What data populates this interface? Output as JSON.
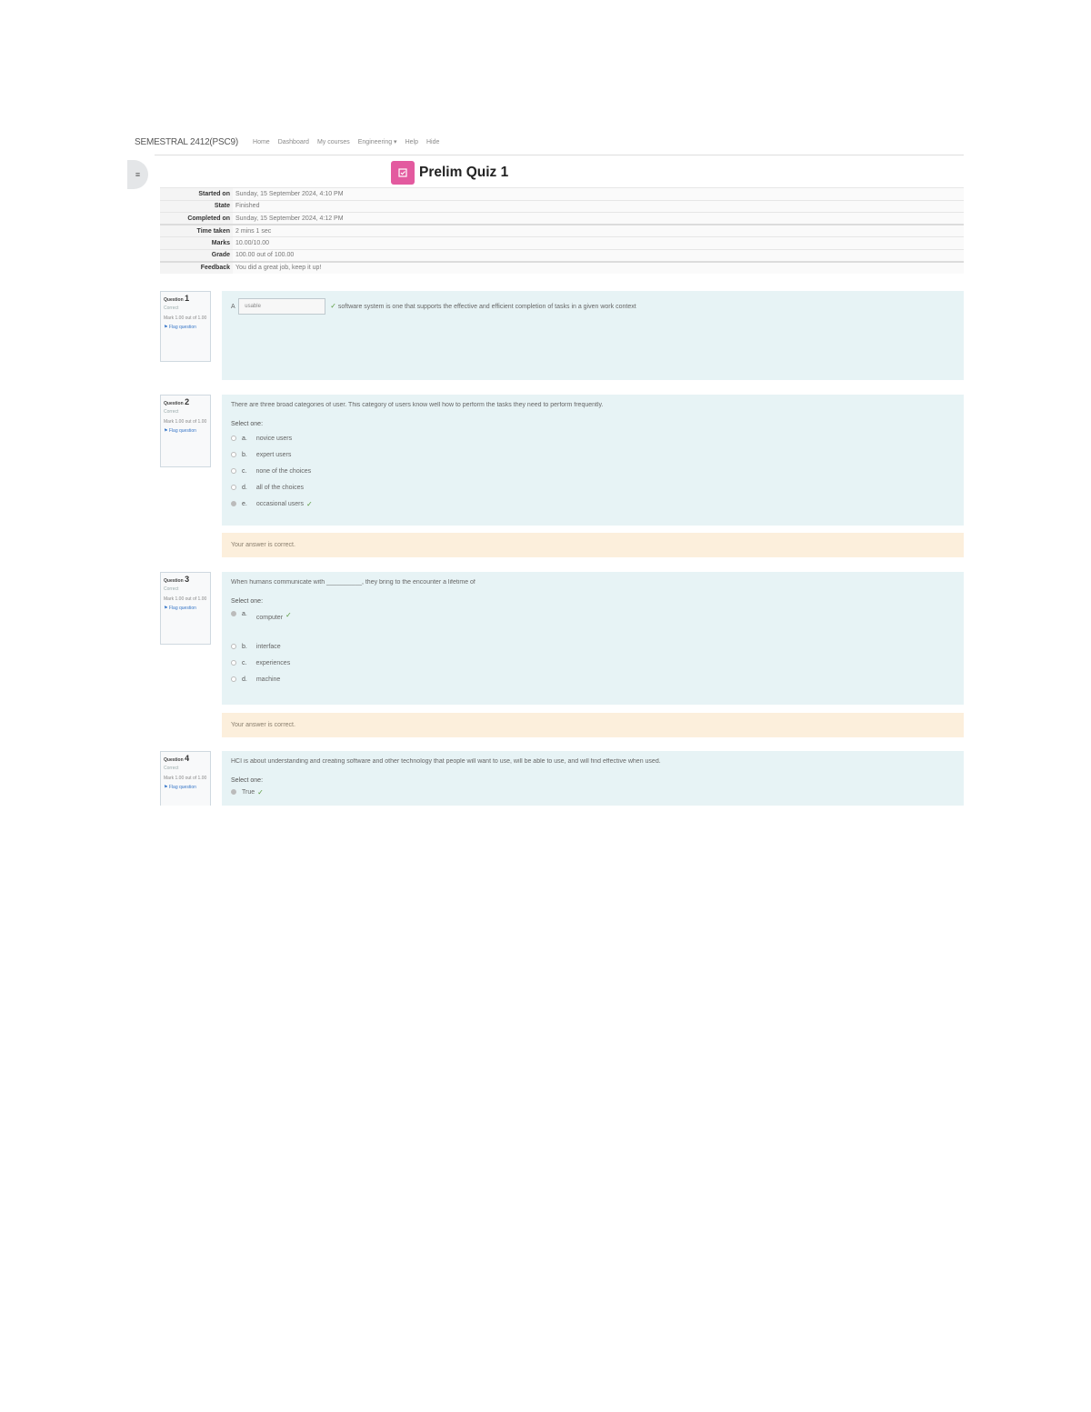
{
  "header": {
    "site_name": "SEMESTRAL 2412(PSC9)",
    "nav": [
      "Home",
      "Dashboard",
      "My courses",
      "Engineering ▾",
      "Help",
      "Hide"
    ]
  },
  "drawer_icon": "≡",
  "quiz": {
    "icon": "quiz-icon",
    "title": "Prelim Quiz 1"
  },
  "summary": [
    {
      "label": "Started on",
      "value": "Sunday, 15 September 2024, 4:10 PM"
    },
    {
      "label": "State",
      "value": "Finished"
    },
    {
      "label": "Completed on",
      "value": "Sunday, 15 September 2024, 4:12 PM"
    },
    {
      "label": "Time taken",
      "value": "2 mins 1 sec"
    },
    {
      "label": "Marks",
      "value": "10.00/10.00"
    },
    {
      "label": "Grade",
      "value": "100.00 out of 100.00"
    },
    {
      "label": "Feedback",
      "value": "You did a great job, keep it up!"
    }
  ],
  "questions": [
    {
      "number_label": "Question",
      "number": "1",
      "state": "Correct",
      "mark": "Mark 1.00 out of 1.00",
      "flag": "Flag question",
      "text_before": "A",
      "answer": "usable",
      "text_after": "software system is one that supports the effective and efficient completion of tasks in a given work context"
    },
    {
      "number_label": "Question",
      "number": "2",
      "state": "Correct",
      "mark": "Mark 1.00 out of 1.00",
      "flag": "Flag question",
      "text": "There are three broad categories of user. This category of users know well how to perform the tasks they need to perform frequently.",
      "select_one": "Select one:",
      "options": [
        {
          "letter": "a.",
          "text": "novice users"
        },
        {
          "letter": "b.",
          "text": "expert users"
        },
        {
          "letter": "c.",
          "text": "none of the choices"
        },
        {
          "letter": "d.",
          "text": "all of the choices"
        },
        {
          "letter": "e.",
          "text": "occasional users"
        }
      ],
      "feedback": "Your answer is correct."
    },
    {
      "number_label": "Question",
      "number": "3",
      "state": "Correct",
      "mark": "Mark 1.00 out of 1.00",
      "flag": "Flag question",
      "text": "When humans communicate with __________, they bring to the encounter a lifetime of",
      "select_one": "Select one:",
      "options": [
        {
          "letter": "a.",
          "text": "computer"
        },
        {
          "letter": "b.",
          "text": "interface"
        },
        {
          "letter": "c.",
          "text": "experiences"
        },
        {
          "letter": "d.",
          "text": "machine"
        }
      ],
      "feedback": "Your answer is correct."
    },
    {
      "number_label": "Question",
      "number": "4",
      "state": "Correct",
      "mark": "Mark 1.00 out of 1.00",
      "flag": "Flag question",
      "text": "HCI is about understanding and creating software and other technology that people will want to use, will be able to use, and will find effective when used.",
      "select_one": "Select one:",
      "options": [
        {
          "letter": "",
          "text": "True"
        }
      ]
    }
  ],
  "colors": {
    "question_bg": "#e7f3f5",
    "feedback_bg": "#fcefdc",
    "quiz_icon": "#e35a9f",
    "check": "#5b9a3e"
  }
}
